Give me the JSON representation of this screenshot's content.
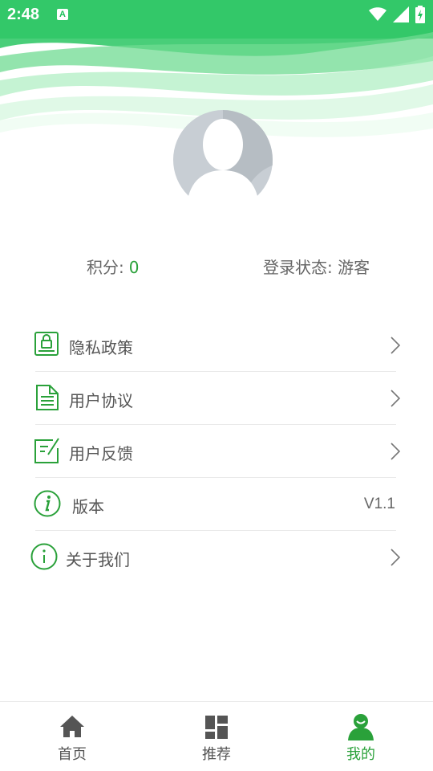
{
  "status_bar": {
    "time": "2:48",
    "notification_glyph": "A"
  },
  "colors": {
    "accent": "#2aa13a",
    "header_green": "#1fc05a"
  },
  "profile": {
    "score_label": "积分:",
    "score_value": "0",
    "login_status": "登录状态: 游客"
  },
  "menu": {
    "items": [
      {
        "label": "隐私政策",
        "icon": "lock-document-icon",
        "has_chevron": true
      },
      {
        "label": "用户协议",
        "icon": "document-icon",
        "has_chevron": true
      },
      {
        "label": "用户反馈",
        "icon": "feedback-edit-icon",
        "has_chevron": true
      },
      {
        "label": "版本",
        "icon": "info-italic-icon",
        "value": "V1.1"
      },
      {
        "label": "关于我们",
        "icon": "info-icon",
        "has_chevron": true
      }
    ]
  },
  "bottom_nav": {
    "items": [
      {
        "label": "首页",
        "icon": "home-icon"
      },
      {
        "label": "推荐",
        "icon": "dashboard-icon"
      },
      {
        "label": "我的",
        "icon": "person-icon",
        "active": true
      }
    ]
  }
}
